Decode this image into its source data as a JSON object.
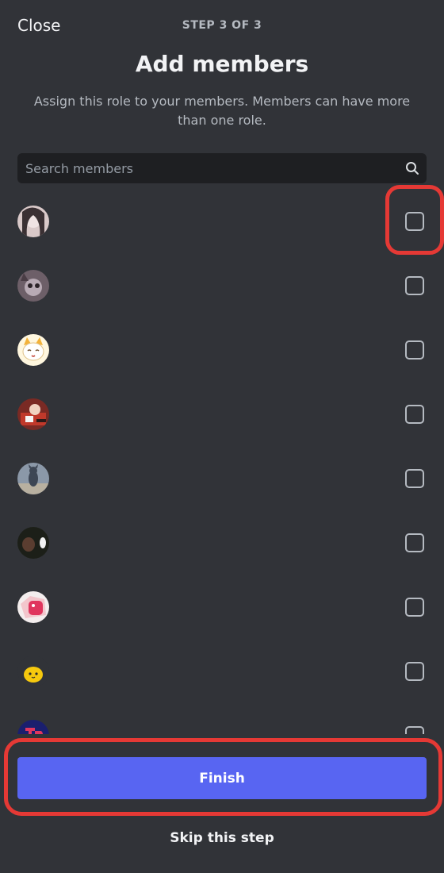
{
  "header": {
    "close_label": "Close",
    "step_label": "STEP 3 OF 3",
    "title": "Add members",
    "subtitle": "Assign this role to your members. Members can have more than one role."
  },
  "search": {
    "placeholder": "Search members",
    "value": ""
  },
  "members": [
    {
      "avatar": "avatar-1",
      "checked": false
    },
    {
      "avatar": "avatar-2",
      "checked": false
    },
    {
      "avatar": "avatar-3",
      "checked": false
    },
    {
      "avatar": "avatar-4",
      "checked": false
    },
    {
      "avatar": "avatar-5",
      "checked": false
    },
    {
      "avatar": "avatar-6",
      "checked": false
    },
    {
      "avatar": "avatar-7",
      "checked": false
    },
    {
      "avatar": "avatar-8",
      "checked": false
    },
    {
      "avatar": "avatar-9",
      "checked": false
    }
  ],
  "footer": {
    "finish_label": "Finish",
    "skip_label": "Skip this step"
  },
  "colors": {
    "background": "#313338",
    "accent": "#5865f2",
    "highlight": "#e53935"
  }
}
